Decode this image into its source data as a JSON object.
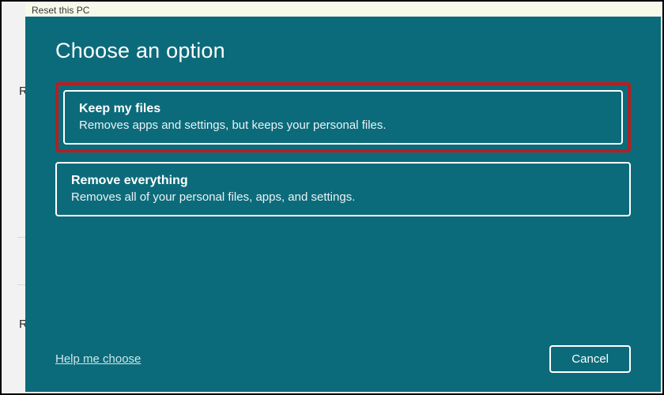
{
  "titleBar": {
    "text": "Reset this PC"
  },
  "background": {
    "textR1": "R",
    "textR2": "R"
  },
  "dialog": {
    "heading": "Choose an option"
  },
  "options": {
    "keepFiles": {
      "title": "Keep my files",
      "description": "Removes apps and settings, but keeps your personal files."
    },
    "removeEverything": {
      "title": "Remove everything",
      "description": "Removes all of your personal files, apps, and settings."
    }
  },
  "footer": {
    "helpLink": "Help me choose",
    "cancel": "Cancel"
  }
}
